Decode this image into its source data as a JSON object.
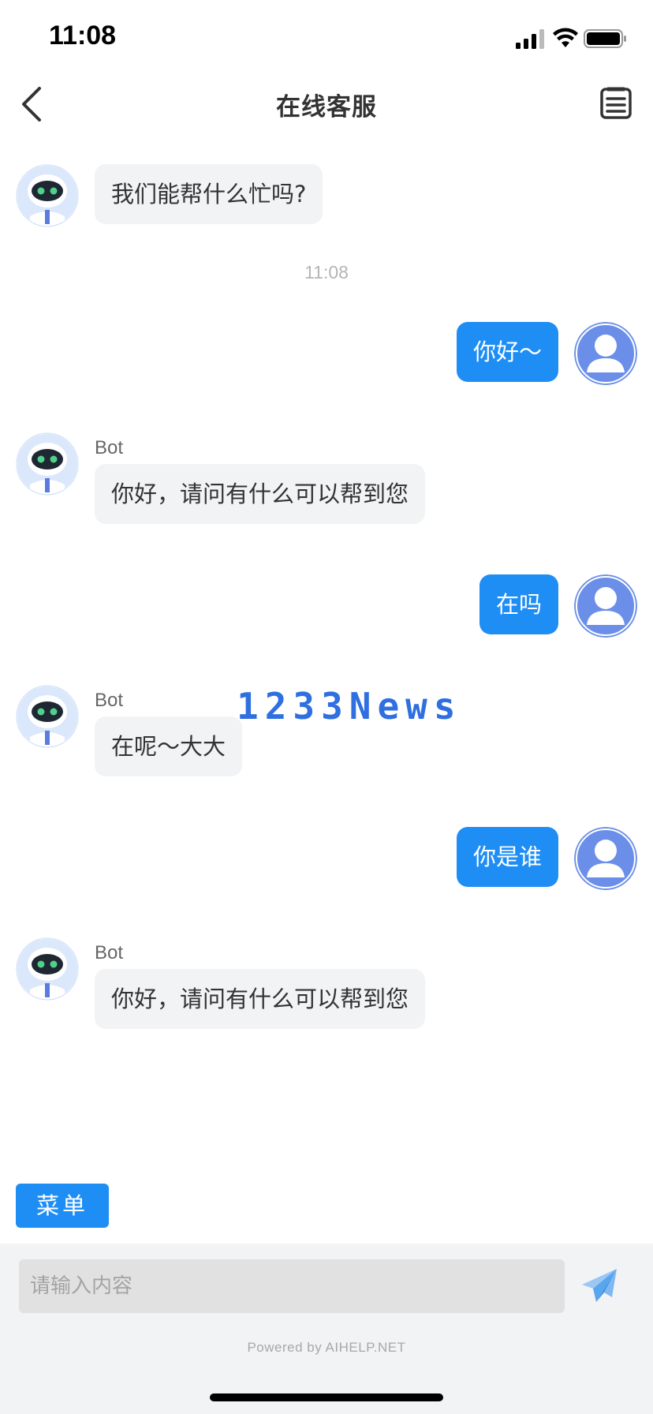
{
  "status_bar": {
    "time": "11:08"
  },
  "header": {
    "title": "在线客服"
  },
  "messages": [
    {
      "from": "bot",
      "sender": "",
      "text": "我们能帮什么忙吗?"
    },
    {
      "type": "timestamp",
      "text": "11:08"
    },
    {
      "from": "user",
      "text": "你好～"
    },
    {
      "from": "bot",
      "sender": "Bot",
      "text": "你好，请问有什么可以帮到您"
    },
    {
      "from": "user",
      "text": "在吗"
    },
    {
      "from": "bot",
      "sender": "Bot",
      "text": "在呢～大大"
    },
    {
      "from": "user",
      "text": "你是谁"
    },
    {
      "from": "bot",
      "sender": "Bot",
      "text": "你好，请问有什么可以帮到您"
    }
  ],
  "watermark": "1233News",
  "menu_button": {
    "label": "菜单"
  },
  "composer": {
    "placeholder": "请输入内容",
    "value": ""
  },
  "footer": {
    "powered_by": "Powered by AIHELP.NET"
  },
  "colors": {
    "accent": "#1e8ef5",
    "bot_bubble": "#f2f3f5",
    "user_avatar": "#6b8fe8",
    "bot_avatar_ring": "#c9dcf8"
  },
  "icons": {
    "back": "chevron-left-icon",
    "menu": "document-list-icon",
    "send": "paper-plane-icon",
    "bot": "robot-avatar-icon",
    "user": "user-avatar-icon"
  }
}
